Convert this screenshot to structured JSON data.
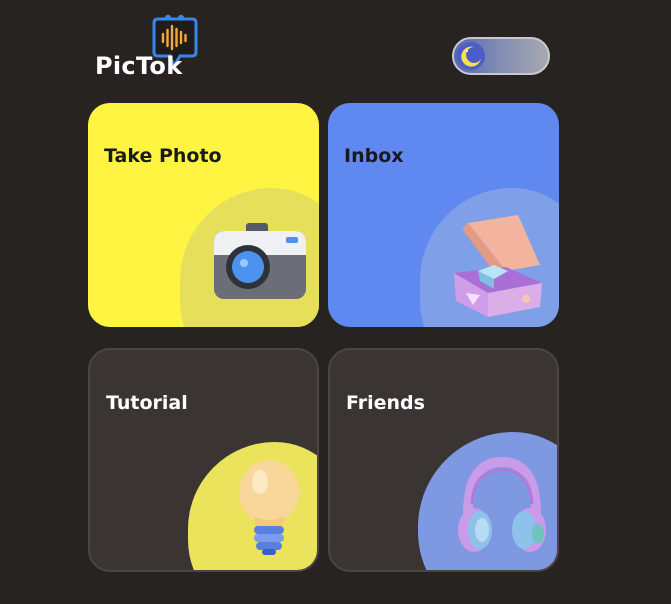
{
  "header": {
    "logo_text": "PicTok",
    "logo_icon": "sound-wave-chat-icon",
    "theme_toggle_icon": "moon-icon"
  },
  "cards": [
    {
      "title": "Take Photo",
      "icon": "camera-icon",
      "color": "#fff442"
    },
    {
      "title": "Inbox",
      "icon": "open-box-icon",
      "color": "#5f88f0"
    },
    {
      "title": "Tutorial",
      "icon": "light-bulb-icon",
      "color": "#3a3533"
    },
    {
      "title": "Friends",
      "icon": "headphones-icon",
      "color": "#3a3533"
    }
  ],
  "colors": {
    "background": "#272320",
    "accent_yellow": "#fff442",
    "accent_blue": "#5f88f0"
  }
}
